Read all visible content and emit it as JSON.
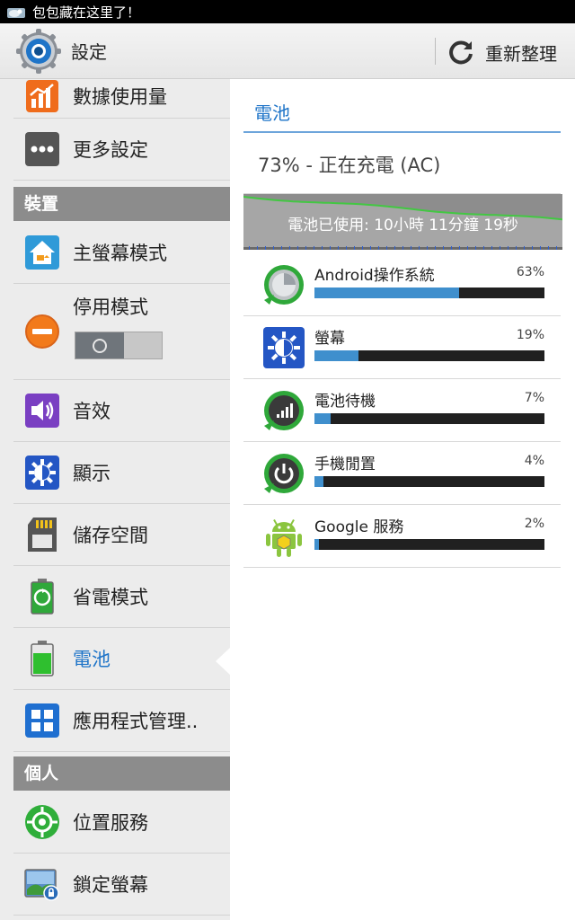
{
  "status_bar": {
    "notification_text": "包包藏在这里了！"
  },
  "action_bar": {
    "title": "設定",
    "refresh_label": "重新整理"
  },
  "sidebar": {
    "items": [
      {
        "label": "數據使用量"
      },
      {
        "label": "更多設定"
      }
    ],
    "sections": [
      {
        "label": "裝置"
      },
      {
        "label": "個人"
      }
    ],
    "device_items": [
      {
        "label": "主螢幕模式"
      },
      {
        "label": "停用模式"
      },
      {
        "label": "音效"
      },
      {
        "label": "顯示"
      },
      {
        "label": "儲存空間"
      },
      {
        "label": "省電模式"
      },
      {
        "label": "電池"
      },
      {
        "label": "應用程式管理.."
      }
    ],
    "personal_items": [
      {
        "label": "位置服務"
      },
      {
        "label": "鎖定螢幕"
      }
    ],
    "active_item": "電池"
  },
  "battery": {
    "title": "電池",
    "status": "73% - 正在充電 (AC)",
    "usage_time": "電池已使用: 10小時 11分鐘 19秒",
    "graph_level": 0.73,
    "usage": [
      {
        "name": "Android操作系統",
        "percent_label": "63%",
        "percent": 63
      },
      {
        "name": "螢幕",
        "percent_label": "19%",
        "percent": 19
      },
      {
        "name": "電池待機",
        "percent_label": "7%",
        "percent": 7
      },
      {
        "name": "手機閒置",
        "percent_label": "4%",
        "percent": 4
      },
      {
        "name": "Google 服務",
        "percent_label": "2%",
        "percent": 2
      }
    ]
  },
  "colors": {
    "accent": "#1e74c8",
    "bar_fill": "#3f8fcd",
    "graph_line": "#43c743"
  }
}
